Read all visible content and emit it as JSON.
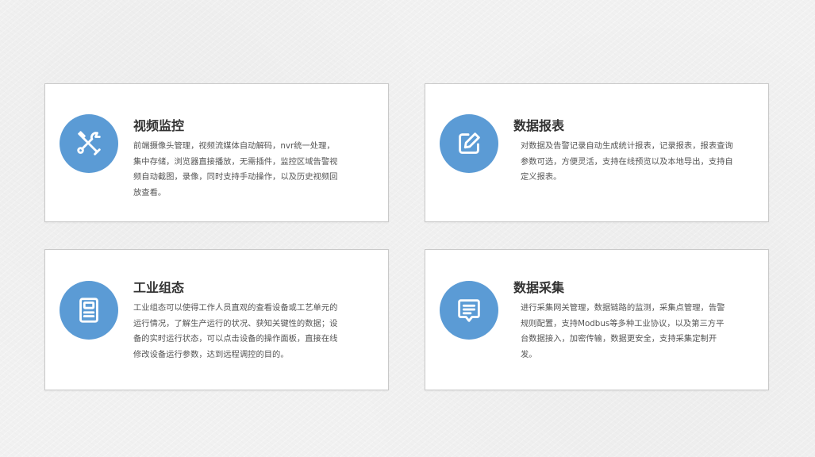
{
  "colors": {
    "accent": "#5b9bd5",
    "card_background": "#ffffff",
    "card_border": "#c9c9c9",
    "title_text": "#333333",
    "body_text": "#555555",
    "page_background": "#f1f1f1"
  },
  "cards": [
    {
      "icon": "tools-icon",
      "title": "视频监控",
      "description": "前端摄像头管理，视频流媒体自动解码，nvr统一处理，集中存储，浏览器直接播放，无需插件，监控区域告警视频自动截图，录像，同时支持手动操作，以及历史视频回放查看。"
    },
    {
      "icon": "edit-icon",
      "title": "数据报表",
      "description": "对数据及告警记录自动生成统计报表，记录报表，报表查询参数可选，方便灵活，支持在线预览以及本地导出，支持自定义报表。"
    },
    {
      "icon": "document-icon",
      "title": "工业组态",
      "description": "工业组态可以使得工作人员直观的查看设备或工艺单元的运行情况，了解生产运行的状况、获知关键性的数据；设备的实时运行状态，可以点击设备的操作面板，直接在线修改设备运行参数，达到远程调控的目的。"
    },
    {
      "icon": "message-icon",
      "title": "数据采集",
      "description": "进行采集网关管理，数据链路的监测，采集点管理，告警规则配置，支持Modbus等多种工业协议，以及第三方平台数据接入，加密传输，数据更安全，支持采集定制开发。"
    }
  ]
}
